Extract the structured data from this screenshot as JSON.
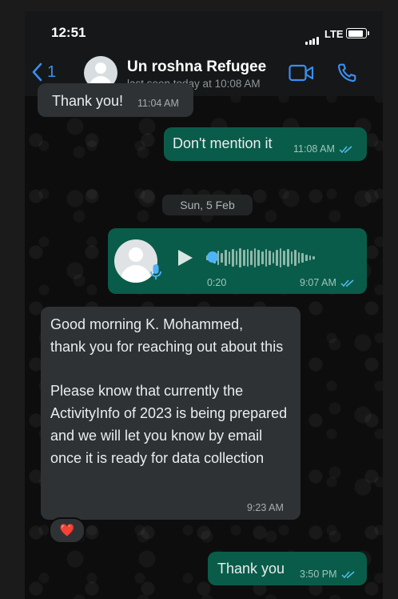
{
  "status_bar": {
    "time": "12:51",
    "network": "LTE"
  },
  "header": {
    "back_count": "1",
    "contact_name": "Un roshna Refugee",
    "last_seen": "last seen today at 10:08 AM",
    "icons": [
      "chevron-left-icon",
      "video-call-icon",
      "phone-icon"
    ],
    "accent_color": "#3a8ef0"
  },
  "messages": [
    {
      "direction": "incoming",
      "text": "Thank you!",
      "time": "11:04 AM"
    },
    {
      "direction": "outgoing",
      "text": "Don't mention it",
      "time": "11:08 AM",
      "read": true
    },
    {
      "type": "date_separator",
      "text": "Sun, 5 Feb"
    },
    {
      "direction": "outgoing",
      "type": "voice_note",
      "duration": "0:20",
      "time": "9:07 AM",
      "read": true,
      "progress": 0
    },
    {
      "direction": "incoming",
      "text": "Good morning K. Mohammed,\nthank you for reaching out about this\n\nPlease know that currently the ActivityInfo of 2023 is being prepared and we will let you know by email once it is ready for data collection",
      "time": "9:23 AM",
      "reaction": "❤️"
    },
    {
      "direction": "outgoing",
      "text": "Thank you",
      "time": "3:50 PM",
      "read": true
    }
  ],
  "colors": {
    "outgoing_bubble": "#0a5c4a",
    "incoming_bubble": "#2f3234",
    "read_ticks": "#53bdeb"
  }
}
